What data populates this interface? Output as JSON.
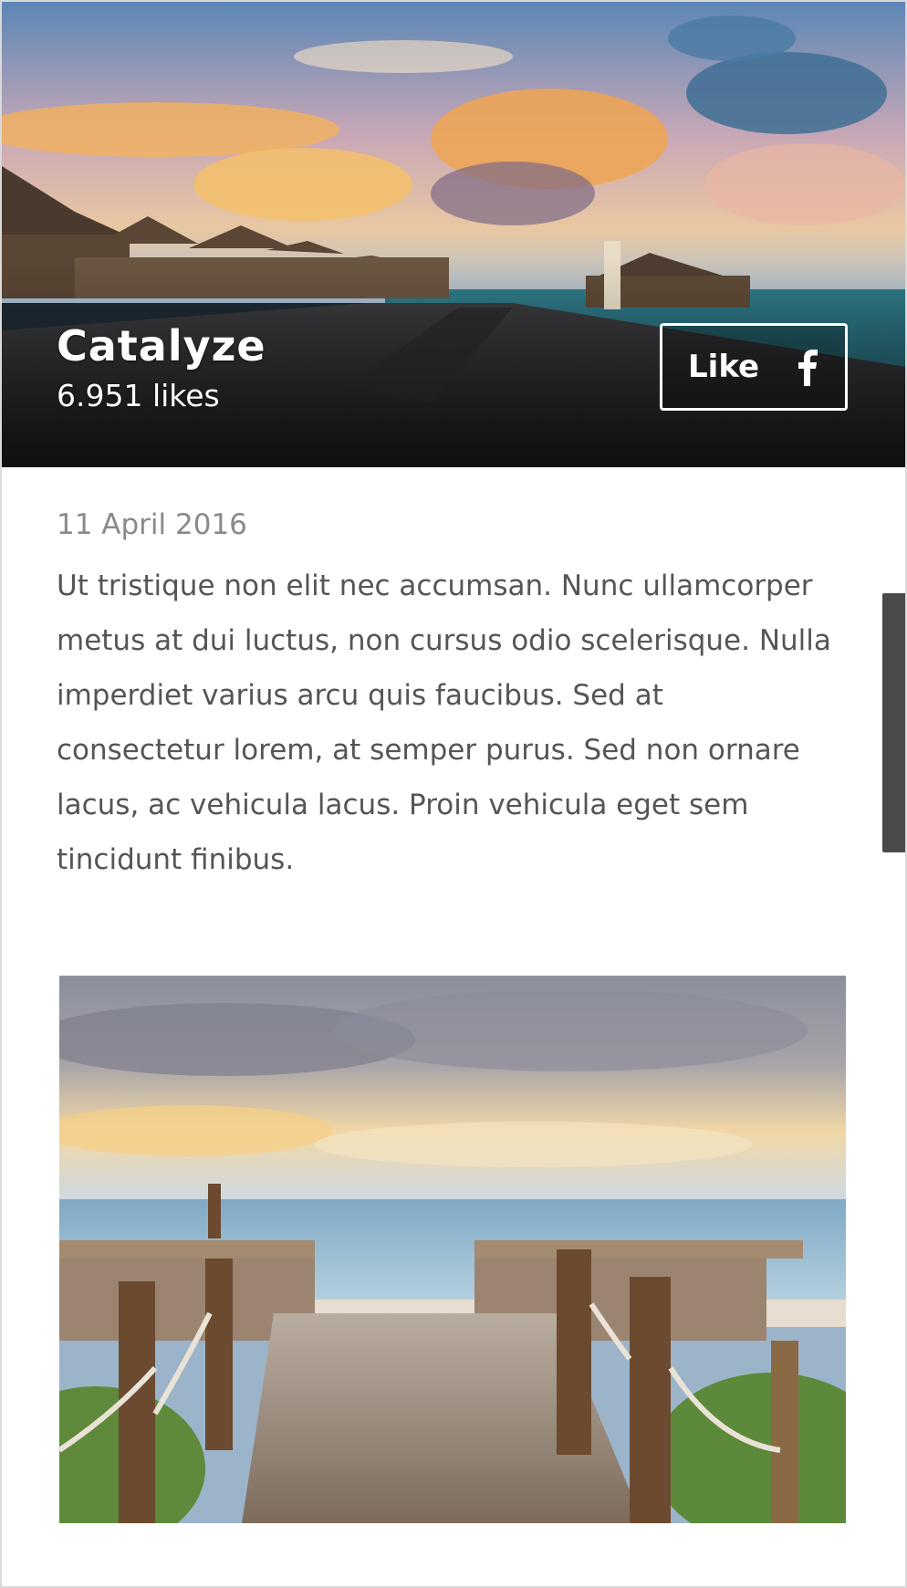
{
  "page": {
    "name": "Catalyze",
    "likes": "6.951 likes"
  },
  "like_button": {
    "label": "Like",
    "icon": "facebook-icon"
  },
  "post": {
    "date": "11 April 2016",
    "text": "Ut tristique non elit nec accumsan. Nunc ullamcorper metus at dui luctus, non cursus odio scelerisque. Nulla imperdiet varius arcu quis faucibus. Sed at consectetur lorem, at semper purus. Sed non ornare lacus, ac vehicula lacus. Proin vehicula eget sem tincidunt finibus."
  },
  "colors": {
    "overlay_text": "#ffffff",
    "date_text": "#8a8a8a",
    "body_text": "#555555",
    "scrollbar": "#4a4a4a"
  }
}
